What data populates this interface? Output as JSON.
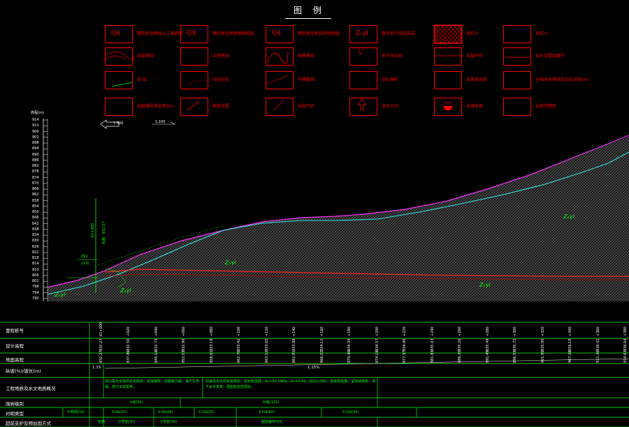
{
  "legend": {
    "title": "图 例",
    "items": [
      {
        "symbol": "Q4",
        "label": "第四系全新统人工堆积层"
      },
      {
        "symbol": "Q4",
        "label": "第四系全新统坡残积层"
      },
      {
        "symbol": "Q4",
        "label": "第四系全新统冲洪积层"
      },
      {
        "symbol": "Zₐγl",
        "label": "震旦系下统花岗岩"
      },
      {
        "symbol": "",
        "label": "碎石土"
      },
      {
        "symbol": "",
        "label": "块石土"
      },
      {
        "symbol": "",
        "label": "岩层界线"
      },
      {
        "symbol": "",
        "label": "岩性界线"
      },
      {
        "symbol": "",
        "label": "地质界线"
      },
      {
        "symbol": "",
        "label": "地下水位线"
      },
      {
        "symbol": "",
        "label": "岩层产状"
      },
      {
        "symbol": "",
        "label": "钻孔位置及编号"
      },
      {
        "symbol": "",
        "label": "岩 层"
      },
      {
        "symbol": "",
        "label": "钻孔柱状"
      },
      {
        "symbol": "",
        "label": "节理裂隙"
      },
      {
        "symbol": "",
        "label": "钻孔编号"
      },
      {
        "symbol": "",
        "label": "岩体风化线"
      },
      {
        "symbol": "",
        "label": "全强风化界线及钻孔深度(m)"
      },
      {
        "symbol": "",
        "label": "岩层编号及岩性(m)"
      },
      {
        "symbol": "",
        "label": "断层位置"
      },
      {
        "symbol": "",
        "label": "岩层产状"
      },
      {
        "symbol": "",
        "label": "流水方向"
      },
      {
        "symbol": "",
        "label": "岩溶发育"
      },
      {
        "symbol": "",
        "label": "岩体完整性"
      }
    ]
  },
  "scale": {
    "axis_unit": "高程(m)",
    "ticks": [
      "914",
      "910",
      "906",
      "902",
      "898",
      "894",
      "890",
      "886",
      "882",
      "878",
      "874",
      "870",
      "866",
      "862",
      "858",
      "854",
      "850",
      "846",
      "842",
      "838",
      "834",
      "830",
      "826",
      "822",
      "818",
      "814",
      "810",
      "806",
      "802",
      "798",
      "794",
      "790"
    ],
    "arrow_left": "1:500",
    "arrow_right": "1:100"
  },
  "annotations": {
    "borehole": "ZK1",
    "chainage": "K1+000",
    "elevation": "标高：832.27",
    "sub1": "ZK1",
    "sub2": "(0.0)",
    "rock_labels": [
      "Zₐγl",
      "Zₐγl",
      "Zₐγl",
      "Zₐγl",
      "Zₐγl"
    ]
  },
  "table": {
    "rows": [
      "里程桩号",
      "设计高程",
      "地面高程",
      "纵坡(%)/坡长(m)",
      "工程地质及水文地质概况",
      "围岩级别",
      "衬砌类型",
      "超前支护及预加固方式"
    ],
    "chainages": [
      "K1+000",
      "+020",
      "+040",
      "+060",
      "+080",
      "+100",
      "+120",
      "+140",
      "+160",
      "+180",
      "+200",
      "+220",
      "+240",
      "+260",
      "+280",
      "+300",
      "+320",
      "+340",
      "+360",
      "+380"
    ],
    "design_elev": [
      "832.27",
      "832.50",
      "832.73",
      "832.96",
      "833.19",
      "833.42",
      "833.65",
      "833.88",
      "834.11",
      "834.34",
      "834.57",
      "834.80",
      "835.03",
      "835.26",
      "835.49",
      "835.72",
      "835.95",
      "836.18",
      "836.41",
      "836.64"
    ],
    "ground_elev": [
      "832.27",
      "837.86",
      "845.14",
      "852.03",
      "858.61",
      "862.70",
      "863.12",
      "862.81",
      "866.02",
      "870.40",
      "874.18",
      "877.97",
      "881.83",
      "886.20",
      "891.49",
      "896.53",
      "901.95",
      "907.28",
      "911.36",
      "914.63"
    ],
    "slope_left": "1.15",
    "slope_right": "1.15%",
    "geology_left": "洞口段为全强风化花岗岩，岩体破碎，自稳能力差，易产生坍塌，地下水较发育。",
    "geology_right": "洞身段为中风化花岗岩，岩石较坚硬，Rc=55.3MPa，Kv=0.49，[BQ]=280，岩体较完整，呈块状结构，地下水不发育，围岩稳定性较好。",
    "grade_left": "V级(50)",
    "grade_right": "IV级(120)",
    "lining": [
      "S-明洞(10)",
      "S-Va(22)",
      "S-Vb(28)",
      "S-IVa(25)",
      "S-IVa(50)",
      "S-IVb(45)"
    ],
    "support": [
      "管棚",
      "小导管(20)",
      "小导管(30)",
      "超前锚杆(54)"
    ]
  }
}
